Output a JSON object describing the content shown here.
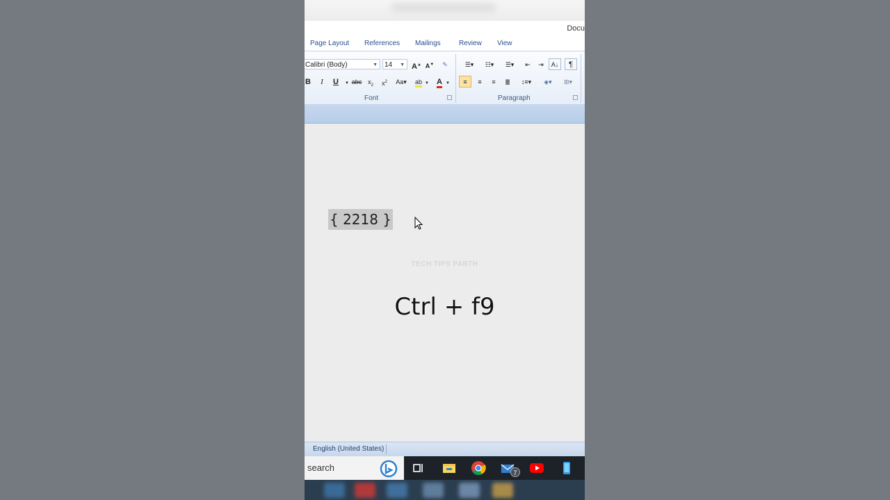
{
  "window": {
    "title": "Docu"
  },
  "tabs": [
    {
      "label": "Page Layout"
    },
    {
      "label": "References"
    },
    {
      "label": "Mailings"
    },
    {
      "label": "Review"
    },
    {
      "label": "View"
    }
  ],
  "ribbon": {
    "font": {
      "family_value": "Calibri (Body)",
      "size_value": "14",
      "group_label": "Font"
    },
    "paragraph": {
      "group_label": "Paragraph"
    }
  },
  "document": {
    "field_code": "{ 2218 }",
    "watermark": "TECH TIPS PARTH",
    "shortcut_caption": "Ctrl + f9"
  },
  "statusbar": {
    "language": "English (United States)"
  },
  "taskbar": {
    "search_text": "search",
    "mail_badge": "7"
  },
  "colors": {
    "ribbon_tab_text": "#2a4f8f",
    "active_button": "#fbe2a6",
    "highlight_yellow": "#f4e23a",
    "font_color_red": "#e0231b",
    "field_shading": "#c9c9c9"
  }
}
